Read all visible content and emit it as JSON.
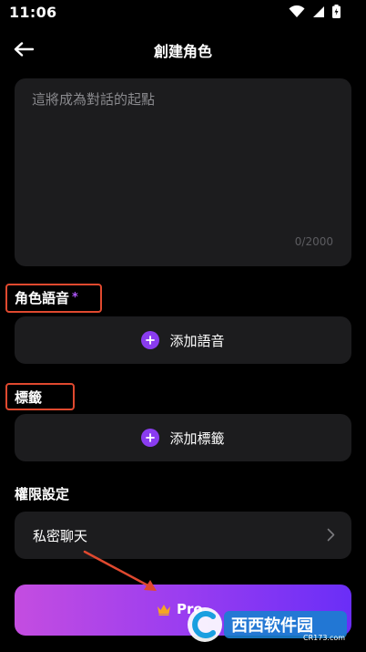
{
  "status_bar": {
    "time": "11:06"
  },
  "header": {
    "title": "創建角色"
  },
  "dialog_input": {
    "placeholder": "這將成為對話的起點",
    "char_count": "0/2000"
  },
  "voice_section": {
    "label": "角色語音",
    "required_mark": "*",
    "add_label": "添加語音"
  },
  "tag_section": {
    "label": "標籤",
    "add_label": "添加標籤"
  },
  "permissions": {
    "label": "權限設定",
    "privacy_value": "私密聊天"
  },
  "pro_button": {
    "label": "Pro"
  },
  "watermark": {
    "text": "西西软件园",
    "sub": "CR173.com"
  },
  "colors": {
    "accent": "#8a3cf0",
    "highlight": "#e0492f",
    "card_bg": "#1c1c1e"
  }
}
